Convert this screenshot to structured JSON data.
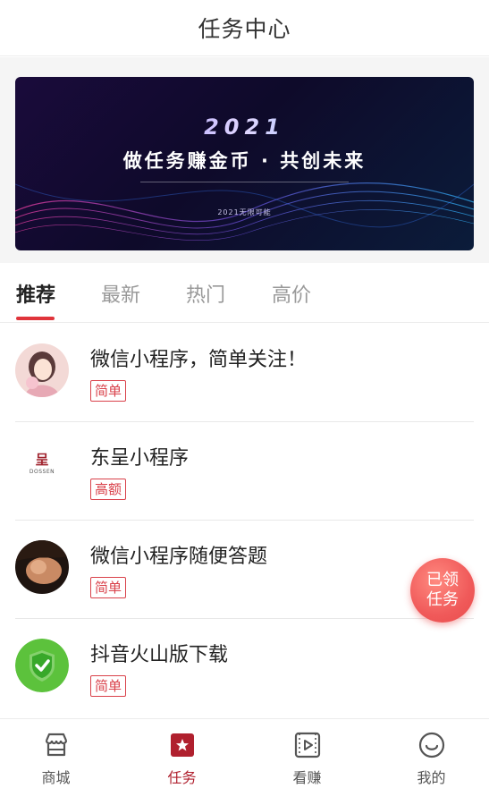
{
  "header": {
    "title": "任务中心"
  },
  "banner": {
    "year": "2021",
    "title": "做任务赚金币 · 共创未来",
    "subtitle": "2021无限可能"
  },
  "tabs": [
    {
      "label": "推荐",
      "active": true
    },
    {
      "label": "最新",
      "active": false
    },
    {
      "label": "热门",
      "active": false
    },
    {
      "label": "高价",
      "active": false
    }
  ],
  "tasks": [
    {
      "title": "微信小程序，简单关注！",
      "tag": "简单",
      "avatar": "illustration-girl"
    },
    {
      "title": "东呈小程序",
      "tag": "高额",
      "avatar": "dossen-logo",
      "avatar_text": "呈",
      "avatar_brand": "DOSSEN"
    },
    {
      "title": "微信小程序随便答题",
      "tag": "简单",
      "avatar": "photo-portrait"
    },
    {
      "title": "抖音火山版下载",
      "tag": "简单",
      "avatar": "shield-check-icon"
    }
  ],
  "float_button": {
    "line1": "已领",
    "line2": "任务"
  },
  "bottom_nav": [
    {
      "label": "商城",
      "icon": "store-icon",
      "active": false
    },
    {
      "label": "任务",
      "icon": "star-task-icon",
      "active": true
    },
    {
      "label": "看赚",
      "icon": "video-play-icon",
      "active": false
    },
    {
      "label": "我的",
      "icon": "smiley-icon",
      "active": false
    }
  ],
  "colors": {
    "accent": "#e0343b",
    "tag": "#d9414a",
    "nav_active": "#b0202e",
    "float": "#f05a5a"
  }
}
